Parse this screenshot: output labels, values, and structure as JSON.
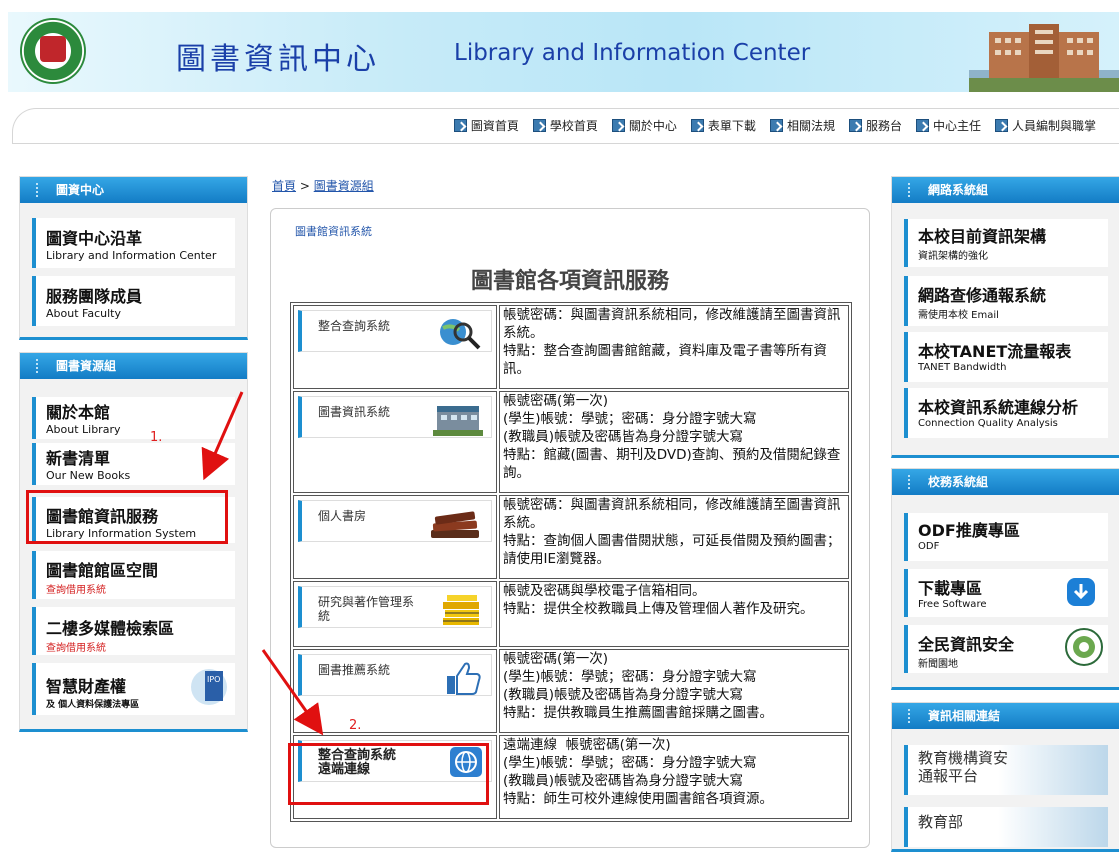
{
  "banner": {
    "title_zh": "圖書資訊中心",
    "title_en": "Library and Information Center"
  },
  "nav": [
    "圖資首頁",
    "學校首頁",
    "關於中心",
    "表單下載",
    "相關法規",
    "服務台",
    "中心主任",
    "人員編制與職掌"
  ],
  "left": {
    "panel1": {
      "title": "圖資中心",
      "items": [
        {
          "zh": "圖資中心沿革",
          "en": "Library and Information Center"
        },
        {
          "zh": "服務團隊成員",
          "en": "About Faculty"
        }
      ]
    },
    "panel2": {
      "title": "圖書資源組",
      "items": [
        {
          "zh": "關於本館",
          "en": "About Library"
        },
        {
          "zh": "新書清單",
          "en": "Our New Books"
        },
        {
          "zh": "圖書館資訊服務",
          "en": "Library Information System"
        },
        {
          "zh": "圖書館館區空間",
          "red": "查詢借用系統"
        },
        {
          "zh": "二樓多媒體檢索區",
          "red": "查詢借用系統"
        },
        {
          "zh": "智慧財產權",
          "en": "及 個人資料保護法專區"
        }
      ]
    }
  },
  "crumb": {
    "home": "首頁",
    "sep": " > ",
    "current": "圖書資源組"
  },
  "main": {
    "system_link": "圖書館資訊系統",
    "heading": "圖書館各項資訊服務",
    "rows": [
      {
        "name": "整合查詢系統",
        "icon": "globe-search-icon",
        "desc": "帳號密碼：與圖書資訊系統相同，修改維護請至圖書資訊系統。\n特點：整合查詢圖書館館藏，資料庫及電子書等所有資訊。"
      },
      {
        "name": "圖書資訊系統",
        "icon": "library-building-icon",
        "desc": "帳號密碼(第一次)\n(學生)帳號：學號；密碼：身分證字號大寫\n(教職員)帳號及密碼皆為身分證字號大寫\n特點：館藏(圖書、期刊及DVD)查詢、預約及借閱紀錄查詢。"
      },
      {
        "name": "個人書房",
        "icon": "books-stack-icon",
        "desc": "帳號密碼：與圖書資訊系統相同，修改維護請至圖書資訊系統。\n特點：查詢個人圖書借閱狀態，可延長借閱及預約圖書；請使用IE瀏覽器。"
      },
      {
        "name": "研究與著作管理系統",
        "icon": "yellow-books-icon",
        "desc": "帳號及密碼與學校電子信箱相同。\n特點：提供全校教職員上傳及管理個人著作及研究。"
      },
      {
        "name": "圖書推薦系統",
        "icon": "thumbs-up-icon",
        "desc": "帳號密碼(第一次)\n(學生)帳號：學號；密碼：身分證字號大寫\n(教職員)帳號及密碼皆為身分證字號大寫\n特點：提供教職員生推薦圖書館採購之圖書。"
      },
      {
        "name": "整合查詢系統\n遠端連線",
        "icon": "globe-icon",
        "desc": "遠端連線  帳號密碼(第一次)\n(學生)帳號：學號；密碼：身分證字號大寫\n(教職員)帳號及密碼皆為身分證字號大寫\n特點：師生可校外連線使用圖書館各項資源。"
      }
    ]
  },
  "right": {
    "panel1": {
      "title": "網路系統組",
      "items": [
        {
          "zh": "本校目前資訊架構",
          "en": "資訊架構的強化"
        },
        {
          "zh": "網路查修通報系統",
          "en": "需使用本校 Email"
        },
        {
          "zh": "本校TANET流量報表",
          "en": "TANET Bandwidth"
        },
        {
          "zh": "本校資訊系統連線分析",
          "en": "Connection Quality Analysis"
        }
      ]
    },
    "panel2": {
      "title": "校務系統組",
      "items": [
        {
          "zh": "ODF推廣專區",
          "en": "ODF"
        },
        {
          "zh": "下載專區",
          "en": "Free Software"
        },
        {
          "zh": "全民資訊安全",
          "en": "新聞園地"
        }
      ]
    },
    "panel3": {
      "title": "資訊相關連結",
      "items": [
        {
          "zh": "教育機構資安\n通報平台"
        },
        {
          "zh": "教育部"
        }
      ]
    }
  },
  "annotations": {
    "a1": "1.",
    "a2": "2."
  },
  "colors": {
    "accent": "#1d8fd0",
    "annotation": "#e01010"
  }
}
